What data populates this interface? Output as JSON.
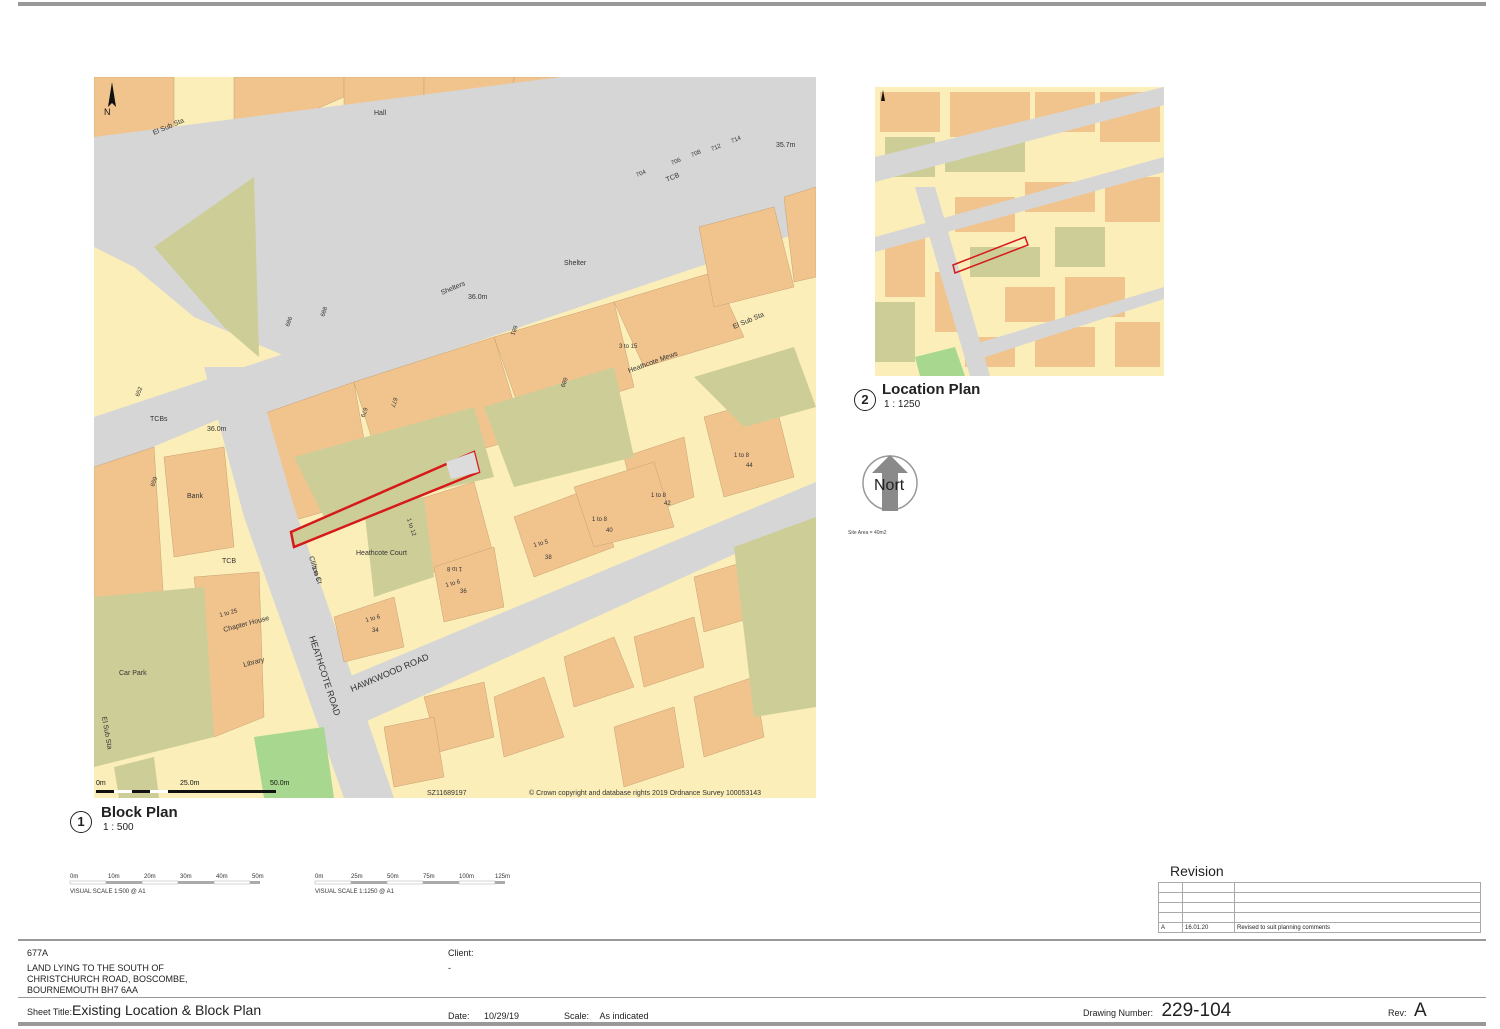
{
  "block_plan": {
    "number": "1",
    "title": "Block Plan",
    "scale": "1 : 500",
    "north_label": "N",
    "roads": [
      "HEATHCOTE ROAD",
      "HAWKWOOD ROAD"
    ],
    "labels": {
      "el_sub_sta_1": "El Sub Sta",
      "el_sub_sta_2": "El Sub Sta",
      "el_sub_sta_3": "El Sub Sta",
      "hall": "Hall",
      "shelters": "Shelters",
      "shelter": "Shelter",
      "tcb_1": "TCB",
      "tcb_2": "TCB",
      "tcbs": "TCBs",
      "bank": "Bank",
      "car_park": "Car Park",
      "library": "Library",
      "chapter_house": "Chapter House",
      "heathcote_court": "Heathcote Court",
      "heathcote_mews": "Heathcote Mews",
      "clifton_ct": "Clifton Ct",
      "level_1": "35.7m",
      "level_2": "36.0m",
      "level_3": "36.0m",
      "n_1to25": "1 to 25",
      "n_1to6a": "1 to 6",
      "n_1to6b": "1 to 6",
      "n_1to6c": "1 to 6",
      "n_1to5": "1 to 5",
      "n_1to8a": "1 to 8",
      "n_1to8b": "1 to 8",
      "n_1to8c": "1 to 8",
      "n_1to8d": "1 to 8",
      "n_1to12": "1 to 12",
      "n_3to15": "3 to 15",
      "n_34": "34",
      "n_36": "36",
      "n_38": "38",
      "n_40": "40",
      "n_42": "42",
      "n_44": "44",
      "n_704": "704",
      "n_706": "706",
      "n_708": "708",
      "n_712": "712",
      "n_714": "714",
      "n_686": "686",
      "n_688": "688",
      "n_652": "652",
      "n_659": "659",
      "n_677": "677",
      "n_679": "679",
      "n_689": "689",
      "n_681": "681"
    },
    "scale_bar": [
      "0m",
      "25.0m",
      "50.0m"
    ],
    "grid_ref": "SZ11689197",
    "copyright": "© Crown copyright and database rights 2019 Ordnance Survey 100053143"
  },
  "location_plan": {
    "number": "2",
    "title": "Location Plan",
    "scale": "1 : 1250"
  },
  "north_arrow": {
    "label": "Nort"
  },
  "site_area": "Site Area = 40m2",
  "visual_scales": [
    {
      "ticks": [
        "0m",
        "10m",
        "20m",
        "30m",
        "40m",
        "50m"
      ],
      "caption": "VISUAL SCALE 1:500  @ A1"
    },
    {
      "ticks": [
        "0m",
        "25m",
        "50m",
        "75m",
        "100m",
        "125m"
      ],
      "caption": "VISUAL SCALE 1:1250  @ A1"
    }
  ],
  "revision": {
    "title": "Revision",
    "rows": [
      {
        "rev": "A",
        "date": "16.01.20",
        "description": "Revised to suit planning comments"
      }
    ]
  },
  "title_block": {
    "project_number": "677A",
    "address": [
      "LAND LYING TO THE SOUTH OF",
      "CHRISTCHURCH ROAD, BOSCOMBE,",
      "BOURNEMOUTH BH7 6AA"
    ],
    "client_label": "Client:",
    "client_value": "-",
    "sheet_title_label": "Sheet Title:",
    "sheet_title": "Existing Location & Block Plan",
    "date_label": "Date:",
    "date": "10/29/19",
    "scale_label": "Scale:",
    "scale": "As indicated",
    "drawing_number_label": "Drawing Number:",
    "drawing_number": "229-104",
    "rev_label": "Rev:",
    "rev": "A"
  },
  "colors": {
    "building": "#f1c48e",
    "ground": "#fbeeb8",
    "garden": "#cdcd98",
    "road": "#d6d6d6",
    "site": "#d61a1a",
    "grass": "#a8d890"
  }
}
